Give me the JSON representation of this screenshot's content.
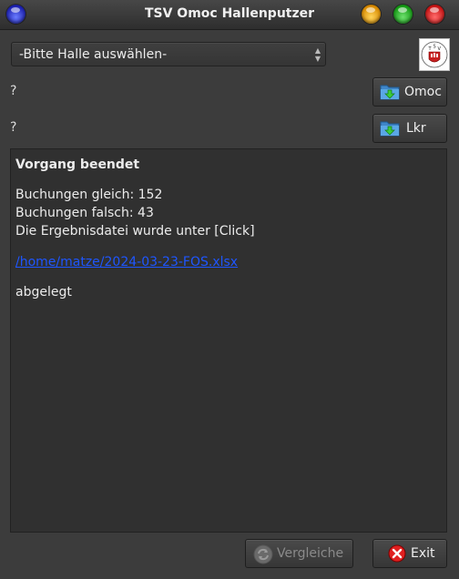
{
  "window": {
    "title": "TSV Omoc Hallenputzer"
  },
  "hall_select": {
    "value": "-Bitte Halle auswählen-"
  },
  "logo": {
    "text": "TSV"
  },
  "rows": [
    {
      "status": "?",
      "button_label": "Omoc",
      "icon": "folder-download-icon"
    },
    {
      "status": "?",
      "button_label": "Lkr",
      "icon": "folder-download-icon"
    }
  ],
  "result": {
    "heading": "Vorgang beendet",
    "line1": "Buchungen gleich: 152",
    "line2": "Buchungen falsch: 43",
    "line3": "Die Ergebnisdatei wurde unter [Click]",
    "link": "/home/matze/2024-03-23-FOS.xlsx",
    "after": "abgelegt"
  },
  "buttons": {
    "compare_label": "Vergleiche",
    "compare_enabled": false,
    "exit_label": "Exit"
  }
}
